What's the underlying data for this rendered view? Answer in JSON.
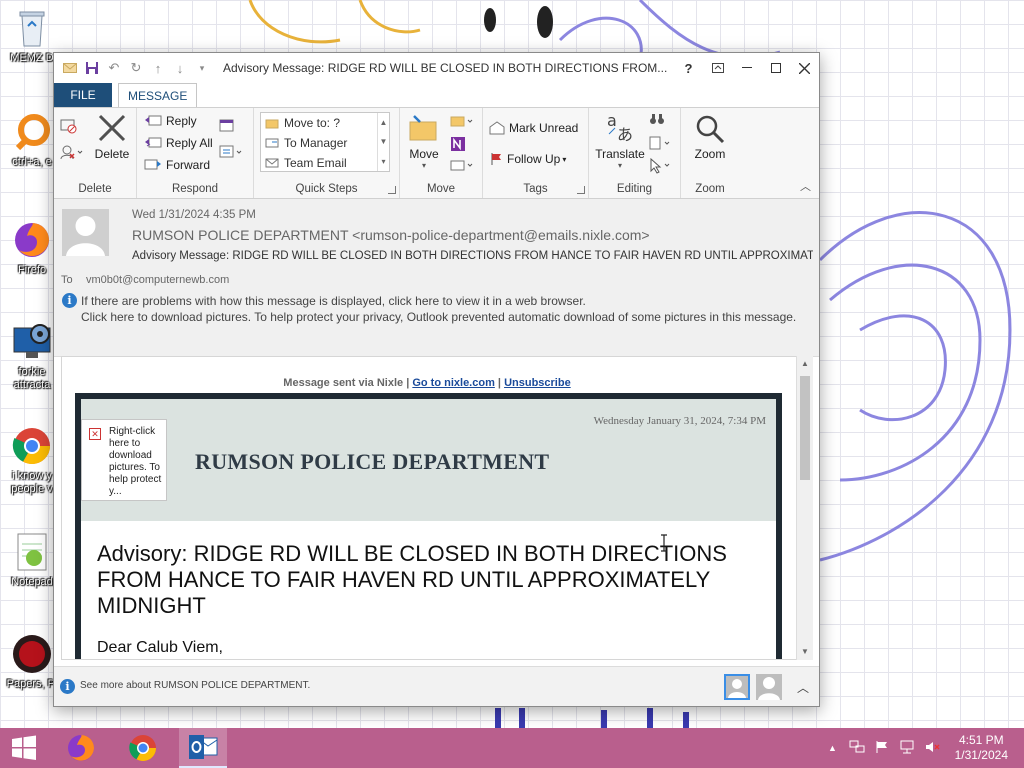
{
  "desktop": {
    "icons": [
      {
        "label": "MEMZ D",
        "icon": "recycle-bin-icon"
      },
      {
        "label": "ctrl+a, e",
        "icon": "orange-app-icon"
      },
      {
        "label": "Firefo",
        "icon": "firefox-icon"
      },
      {
        "label": "forkie attracta",
        "icon": "settings-monitor-icon"
      },
      {
        "label": "i know y people v",
        "icon": "chrome-icon"
      },
      {
        "label": "Notepad",
        "icon": "notepad-icon"
      },
      {
        "label": "Papers, Pl",
        "icon": "papers-please-icon"
      }
    ]
  },
  "window": {
    "title": "Advisory Message: RIDGE RD WILL BE CLOSED IN BOTH DIRECTIONS FROM...",
    "help": "?",
    "tabs": {
      "file": "FILE",
      "message": "MESSAGE"
    }
  },
  "ribbon": {
    "delete_group": {
      "label": "Delete",
      "delete_btn": "Delete"
    },
    "respond_group": {
      "label": "Respond",
      "reply": "Reply",
      "reply_all": "Reply All",
      "forward": "Forward"
    },
    "quick_steps_group": {
      "label": "Quick Steps",
      "items": [
        "Move to: ?",
        "To Manager",
        "Team Email"
      ]
    },
    "move_group": {
      "label": "Move",
      "move_btn": "Move"
    },
    "tags_group": {
      "label": "Tags",
      "mark_unread": "Mark Unread",
      "follow_up": "Follow Up"
    },
    "editing_group": {
      "label": "Editing",
      "translate": "Translate"
    },
    "zoom_group": {
      "label": "Zoom",
      "zoom_btn": "Zoom"
    }
  },
  "message": {
    "date": "Wed 1/31/2024 4:35 PM",
    "from": "RUMSON POLICE DEPARTMENT <rumson-police-department@emails.nixle.com>",
    "subject": "Advisory Message: RIDGE RD WILL BE CLOSED IN BOTH DIRECTIONS FROM HANCE TO FAIR HAVEN RD UNTIL APPROXIMATELY MIDNIGHT",
    "to_label": "To",
    "to": "vm0b0t@computernewb.com",
    "info_line1": "If there are problems with how this message is displayed, click here to view it in a web browser.",
    "info_line2": "Click here to download pictures. To help protect your privacy, Outlook prevented automatic download of some pictures in this message."
  },
  "email_body": {
    "sent_via": "Message sent via Nixle |",
    "sep": "|",
    "goto_link": "Go to nixle.com",
    "unsubscribe_link": "Unsubscribe",
    "email_date": "Wednesday January 31, 2024, 7:34 PM",
    "broken_image_text": "Right-click here to download pictures. To help protect y...",
    "department": "RUMSON POLICE DEPARTMENT",
    "heading": "Advisory: RIDGE RD WILL BE CLOSED IN BOTH DIRECTIONS FROM HANCE TO FAIR HAVEN RD UNTIL APPROXIMATELY MIDNIGHT",
    "greeting": "Dear Calub Viem,"
  },
  "people_bar": {
    "text": "See more about RUMSON POLICE DEPARTMENT."
  },
  "taskbar": {
    "apps": [
      "windows-start-icon",
      "firefox-icon",
      "chrome-icon",
      "outlook-icon"
    ],
    "time": "4:51 PM",
    "date": "1/31/2024"
  }
}
